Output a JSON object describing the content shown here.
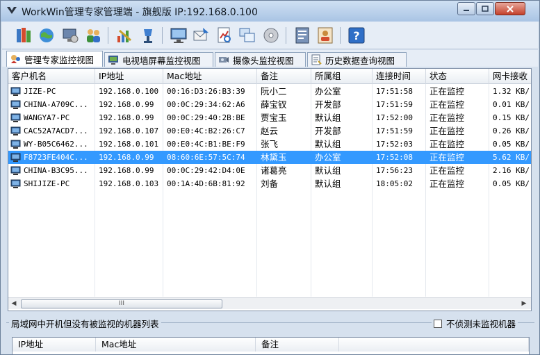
{
  "window": {
    "title": "WorkWin管理专家管理端 - 旗舰版 IP:192.168.0.100"
  },
  "toolbar": {
    "buttons": [
      {
        "name": "books-icon"
      },
      {
        "name": "globe-icon"
      },
      {
        "name": "computer-settings-icon"
      },
      {
        "name": "users-icon"
      },
      {
        "name": "chart-pen-icon"
      },
      {
        "name": "lamp-icon"
      },
      {
        "name": "monitor-icon"
      },
      {
        "name": "send-message-icon"
      },
      {
        "name": "document-chart-icon"
      },
      {
        "name": "windows-icon"
      },
      {
        "name": "disc-icon"
      },
      {
        "name": "report-icon"
      },
      {
        "name": "person-card-icon"
      },
      {
        "name": "help-icon"
      }
    ]
  },
  "tabs": [
    {
      "label": "管理专家监控视图",
      "icon": "monitor-view-icon",
      "active": true
    },
    {
      "label": "电视墙屏幕监控视图",
      "icon": "tv-wall-icon",
      "active": false
    },
    {
      "label": "摄像头监控视图",
      "icon": "camera-icon",
      "active": false
    },
    {
      "label": "历史数据查询视图",
      "icon": "history-icon",
      "active": false
    }
  ],
  "table": {
    "columns": [
      "客户机名",
      "IP地址",
      "Mac地址",
      "备注",
      "所属组",
      "连接时间",
      "状态",
      "网卡接收"
    ],
    "rows": [
      [
        "JIZE-PC",
        "192.168.0.100",
        "00:16:D3:26:B3:39",
        "阮小二",
        "办公室",
        "17:51:58",
        "正在监控",
        "1.32 KB/"
      ],
      [
        "CHINA-A709C...",
        "192.168.0.99",
        "00:0C:29:34:62:A6",
        "薛宝钗",
        "开发部",
        "17:51:59",
        "正在监控",
        "0.01 KB/"
      ],
      [
        "WANGYA7-PC",
        "192.168.0.99",
        "00:0C:29:40:2B:BE",
        "贾宝玉",
        "默认组",
        "17:52:00",
        "正在监控",
        "0.15 KB/"
      ],
      [
        "CAC52A7ACD7...",
        "192.168.0.107",
        "00:E0:4C:B2:26:C7",
        "赵云",
        "开发部",
        "17:51:59",
        "正在监控",
        "0.26 KB/"
      ],
      [
        "WY-B05C6462...",
        "192.168.0.101",
        "00:E0:4C:B1:BE:F9",
        "张飞",
        "默认组",
        "17:52:03",
        "正在监控",
        "0.05 KB/"
      ],
      [
        "F8723FE404C...",
        "192.168.0.99",
        "08:60:6E:57:5C:74",
        "林黛玉",
        "办公室",
        "17:52:08",
        "正在监控",
        "5.62 KB/"
      ],
      [
        "CHINA-B3C95...",
        "192.168.0.99",
        "00:0C:29:42:D4:0E",
        "诸葛亮",
        "默认组",
        "17:56:23",
        "正在监控",
        "2.16 KB/"
      ],
      [
        "SHIJIZE-PC",
        "192.168.0.103",
        "00:1A:4D:6B:81:92",
        "刘备",
        "默认组",
        "18:05:02",
        "正在监控",
        "0.05 KB/"
      ]
    ],
    "selected_row": 5,
    "scroll_thumb_label": "III"
  },
  "bottom": {
    "title": "局域网中开机但没有被监视的机器列表",
    "checkbox_label": "不侦测未监视机器",
    "columns": [
      "IP地址",
      "Mac地址",
      "备注"
    ]
  }
}
